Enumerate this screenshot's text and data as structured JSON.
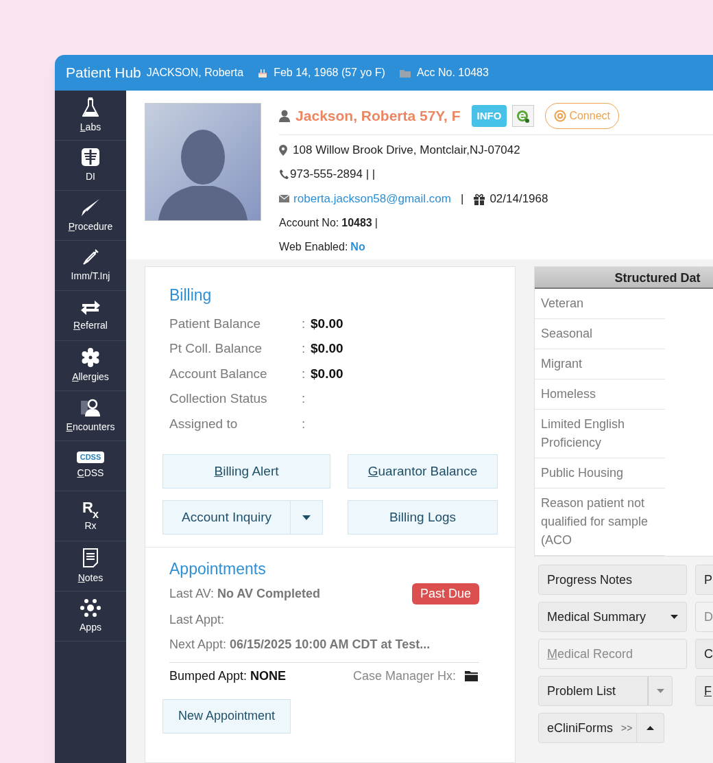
{
  "title_bar": {
    "app": "Patient Hub",
    "patient": "JACKSON, Roberta",
    "dob": "Feb 14, 1968 (57 yo F)",
    "account": "Acc No. 10483"
  },
  "sidebar": {
    "items": [
      {
        "label": "Labs",
        "access_key": true,
        "kind": "flask"
      },
      {
        "label": "DI",
        "access_key": false,
        "kind": "scan"
      },
      {
        "label": "Procedure",
        "access_key": true,
        "kind": "scalpel"
      },
      {
        "label": "Imm/T.Inj",
        "access_key": false,
        "kind": "syringe"
      },
      {
        "label": "Referral",
        "access_key": true,
        "kind": "arrows"
      },
      {
        "label": "Allergies",
        "access_key": true,
        "kind": "gear"
      },
      {
        "label": "Encounters",
        "access_key": true,
        "kind": "person"
      },
      {
        "label": "CDSS",
        "access_key": true,
        "kind": "cdss",
        "badge": "CDSS"
      },
      {
        "label": "Rx",
        "access_key": false,
        "kind": "rx",
        "glyph_main": "R",
        "glyph_sub": "x"
      },
      {
        "label": "Notes",
        "access_key": true,
        "kind": "note"
      },
      {
        "label": "Apps",
        "access_key": false,
        "kind": "apps"
      }
    ]
  },
  "patient": {
    "name": "Jackson, Roberta 57Y, F",
    "info_badge": "INFO",
    "connect": "Connect",
    "address": "108 Willow Brook Drive, Montclair,NJ-07042",
    "phone": "973-555-2894 | |",
    "email": "roberta.jackson58@gmail.com",
    "email_sep": "|",
    "birthday": "02/14/1968",
    "account_label": "Account No:",
    "account_value": "10483",
    "account_sep": "|",
    "web_label": "Web Enabled:",
    "web_value": "No"
  },
  "billing": {
    "title": "Billing",
    "rows": [
      {
        "label": "Patient Balance",
        "sep": ":",
        "value": "$0.00"
      },
      {
        "label": "Pt Coll. Balance",
        "sep": ":",
        "value": "$0.00"
      },
      {
        "label": "Account Balance",
        "sep": ":",
        "value": "$0.00"
      },
      {
        "label": "Collection Status",
        "sep": ":"
      },
      {
        "label": "Assigned to",
        "sep": ":"
      }
    ],
    "buttons": [
      {
        "label": "Billing Alert",
        "kind": "plain",
        "access_key": true
      },
      {
        "label": "Guarantor Balance",
        "kind": "plain",
        "access_key": true
      },
      {
        "label": "Account Inquiry",
        "kind": "split",
        "access_key": false
      },
      {
        "label": "Billing Logs",
        "kind": "plain",
        "access_key": false
      }
    ]
  },
  "appointments": {
    "title": "Appointments",
    "last_av_label": "Last AV:",
    "last_av_value": "No AV Completed",
    "badge": "Past Due",
    "last_appt_label": "Last Appt:",
    "next_appt_label": "Next Appt:",
    "next_appt_value": "06/15/2025 10:00 AM CDT at Test...",
    "bumped_label": "Bumped Appt:",
    "bumped_value": "NONE",
    "case_manager_label": "Case Manager Hx:",
    "new_button": "New Appointment"
  },
  "structured_data": {
    "header": "Structured Dat",
    "rows": [
      "Veteran",
      "Seasonal",
      "Migrant",
      "Homeless",
      "Limited English Proficiency",
      "Public Housing",
      "Reason patient not qualified for sample (ACO"
    ]
  },
  "actions": [
    {
      "label": "Progress Notes",
      "kind": "plain",
      "disabled": false,
      "access_key": false
    },
    {
      "label": "P",
      "kind": "plain",
      "disabled": false,
      "access_key": false
    },
    {
      "label": "Medical Summary",
      "kind": "menu",
      "disabled": false,
      "access_key": false
    },
    {
      "label": "D",
      "kind": "plain",
      "disabled": true,
      "access_key": false
    },
    {
      "label": "Medical Record",
      "kind": "plain",
      "disabled": true,
      "access_key": true
    },
    {
      "label": "C",
      "kind": "plain",
      "disabled": false,
      "access_key": false
    },
    {
      "label": "Problem List",
      "kind": "split",
      "disabled": false,
      "access_key": false
    },
    {
      "label": "F",
      "kind": "plain",
      "disabled": false,
      "access_key": true
    },
    {
      "label": "eCliniForms",
      "kind": "expander",
      "more": ">>",
      "disabled": false,
      "access_key": false
    }
  ]
}
